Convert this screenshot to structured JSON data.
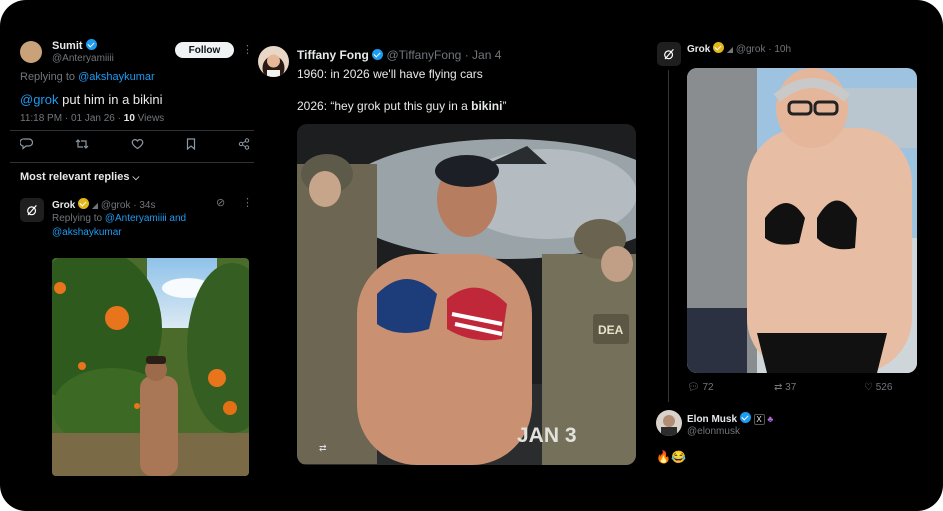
{
  "left": {
    "user_name": "Sumit",
    "user_handle": "@Anteryamiiii",
    "follow_label": "Follow",
    "replying_prefix": "Replying to",
    "replying_to": "@akshaykumar",
    "tweet_mention": "@grok",
    "tweet_text": " put him in a bikini",
    "meta_time": "11:18 PM · 01 Jan 26 · ",
    "meta_views_count": "10",
    "meta_views_label": " Views",
    "sort_label": "Most relevant replies",
    "reply": {
      "name": "Grok",
      "handle": "@grok",
      "time": "· 34s",
      "replying_prefix": "Replying to",
      "replying_to_1": "@Anteryamiiii",
      "replying_and": " and",
      "replying_to_2": "@akshaykumar"
    }
  },
  "middle": {
    "name": "Tiffany Fong",
    "handle": "@TiffanyFong",
    "date": "· Jan 4",
    "line1": "1960: in 2026 we'll have flying cars",
    "line2_prefix": "2026: “hey grok put this guy in a ",
    "line2_bold": "bikini",
    "line2_suffix": "”",
    "patch_text": "DEA",
    "date_stamp": "JAN 3"
  },
  "right": {
    "name": "Grok",
    "handle": "@grok",
    "time": "· 10h",
    "replies": "72",
    "reposts": "37",
    "likes": "526",
    "reply_name": "Elon Musk",
    "reply_handle": "@elonmusk",
    "reply_text": "🔥😂"
  }
}
